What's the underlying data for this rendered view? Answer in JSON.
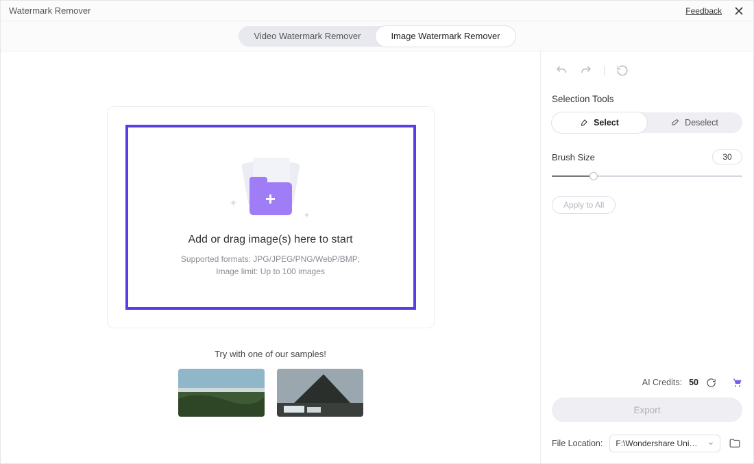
{
  "titlebar": {
    "app_title": "Watermark Remover",
    "feedback": "Feedback"
  },
  "tabs": {
    "video": "Video Watermark Remover",
    "image": "Image Watermark Remover"
  },
  "dropzone": {
    "headline": "Add or drag image(s) here to start",
    "formats": "Supported formats: JPG/JPEG/PNG/WebP/BMP;",
    "limit": "Image limit: Up to 100 images"
  },
  "samples": {
    "label": "Try with one of our samples!"
  },
  "sidebar": {
    "selection_title": "Selection Tools",
    "select_label": "Select",
    "deselect_label": "Deselect",
    "brush_label": "Brush Size",
    "brush_value": "30",
    "apply_all": "Apply to All",
    "credits_label": "AI Credits:",
    "credits_value": "50",
    "export": "Export",
    "file_location_label": "File Location:",
    "file_location_value": "F:\\Wondershare UniCon"
  }
}
